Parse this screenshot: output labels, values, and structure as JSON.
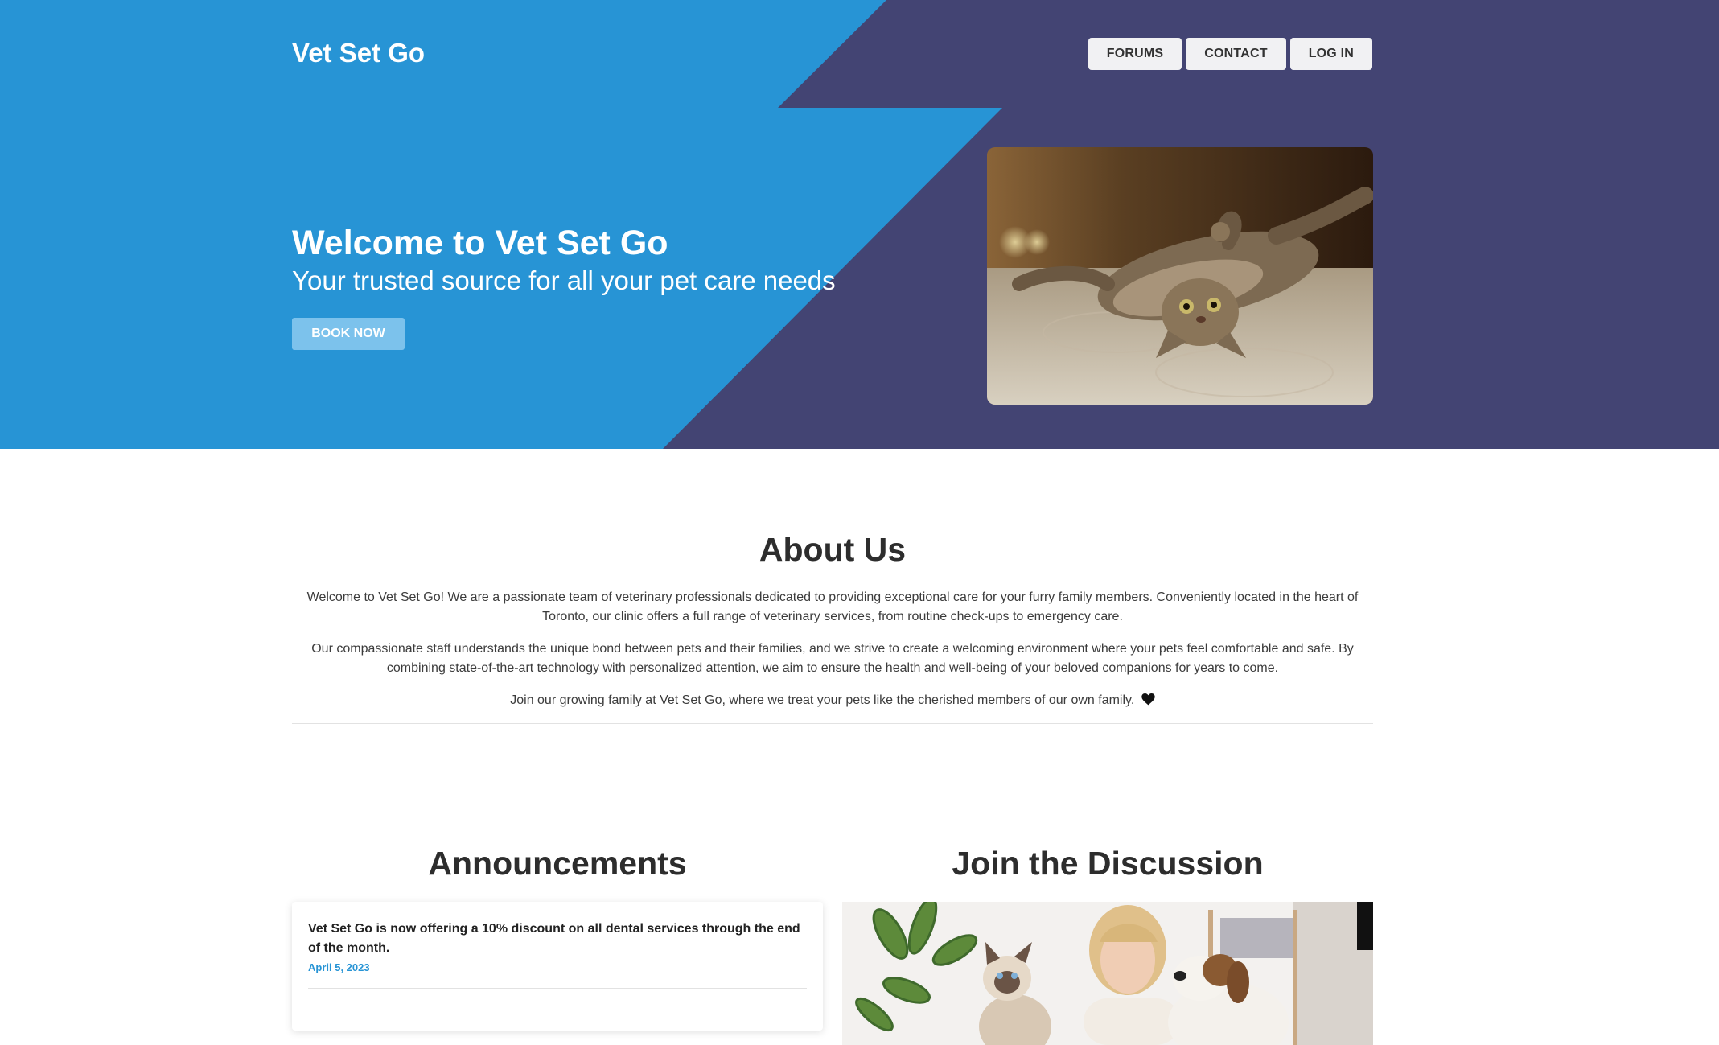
{
  "brand": "Vet Set Go",
  "nav": {
    "forums": "FORUMS",
    "contact": "CONTACT",
    "login": "LOG IN"
  },
  "hero": {
    "title": "Welcome to Vet Set Go",
    "subtitle": "Your trusted source for all your pet care needs",
    "cta": "BOOK NOW"
  },
  "about": {
    "title": "About Us",
    "p1": "Welcome to Vet Set Go! We are a passionate team of veterinary professionals dedicated to providing exceptional care for your furry family members. Conveniently located in the heart of Toronto, our clinic offers a full range of veterinary services, from routine check-ups to emergency care.",
    "p2": "Our compassionate staff understands the unique bond between pets and their families, and we strive to create a welcoming environment where your pets feel comfortable and safe. By combining state-of-the-art technology with personalized attention, we aim to ensure the health and well-being of your beloved companions for years to come.",
    "p3": "Join our growing family at Vet Set Go, where we treat your pets like the cherished members of our own family."
  },
  "announcements": {
    "title": "Announcements",
    "items": [
      {
        "text": "Vet Set Go is now offering a 10% discount on all dental services through the end of the month.",
        "date": "April 5, 2023"
      }
    ]
  },
  "discussion": {
    "title": "Join the Discussion"
  },
  "colors": {
    "hero_blue": "#2794d5",
    "hero_purple": "#434473",
    "button_light": "#7cc2ec",
    "date_blue": "#2794d5"
  }
}
